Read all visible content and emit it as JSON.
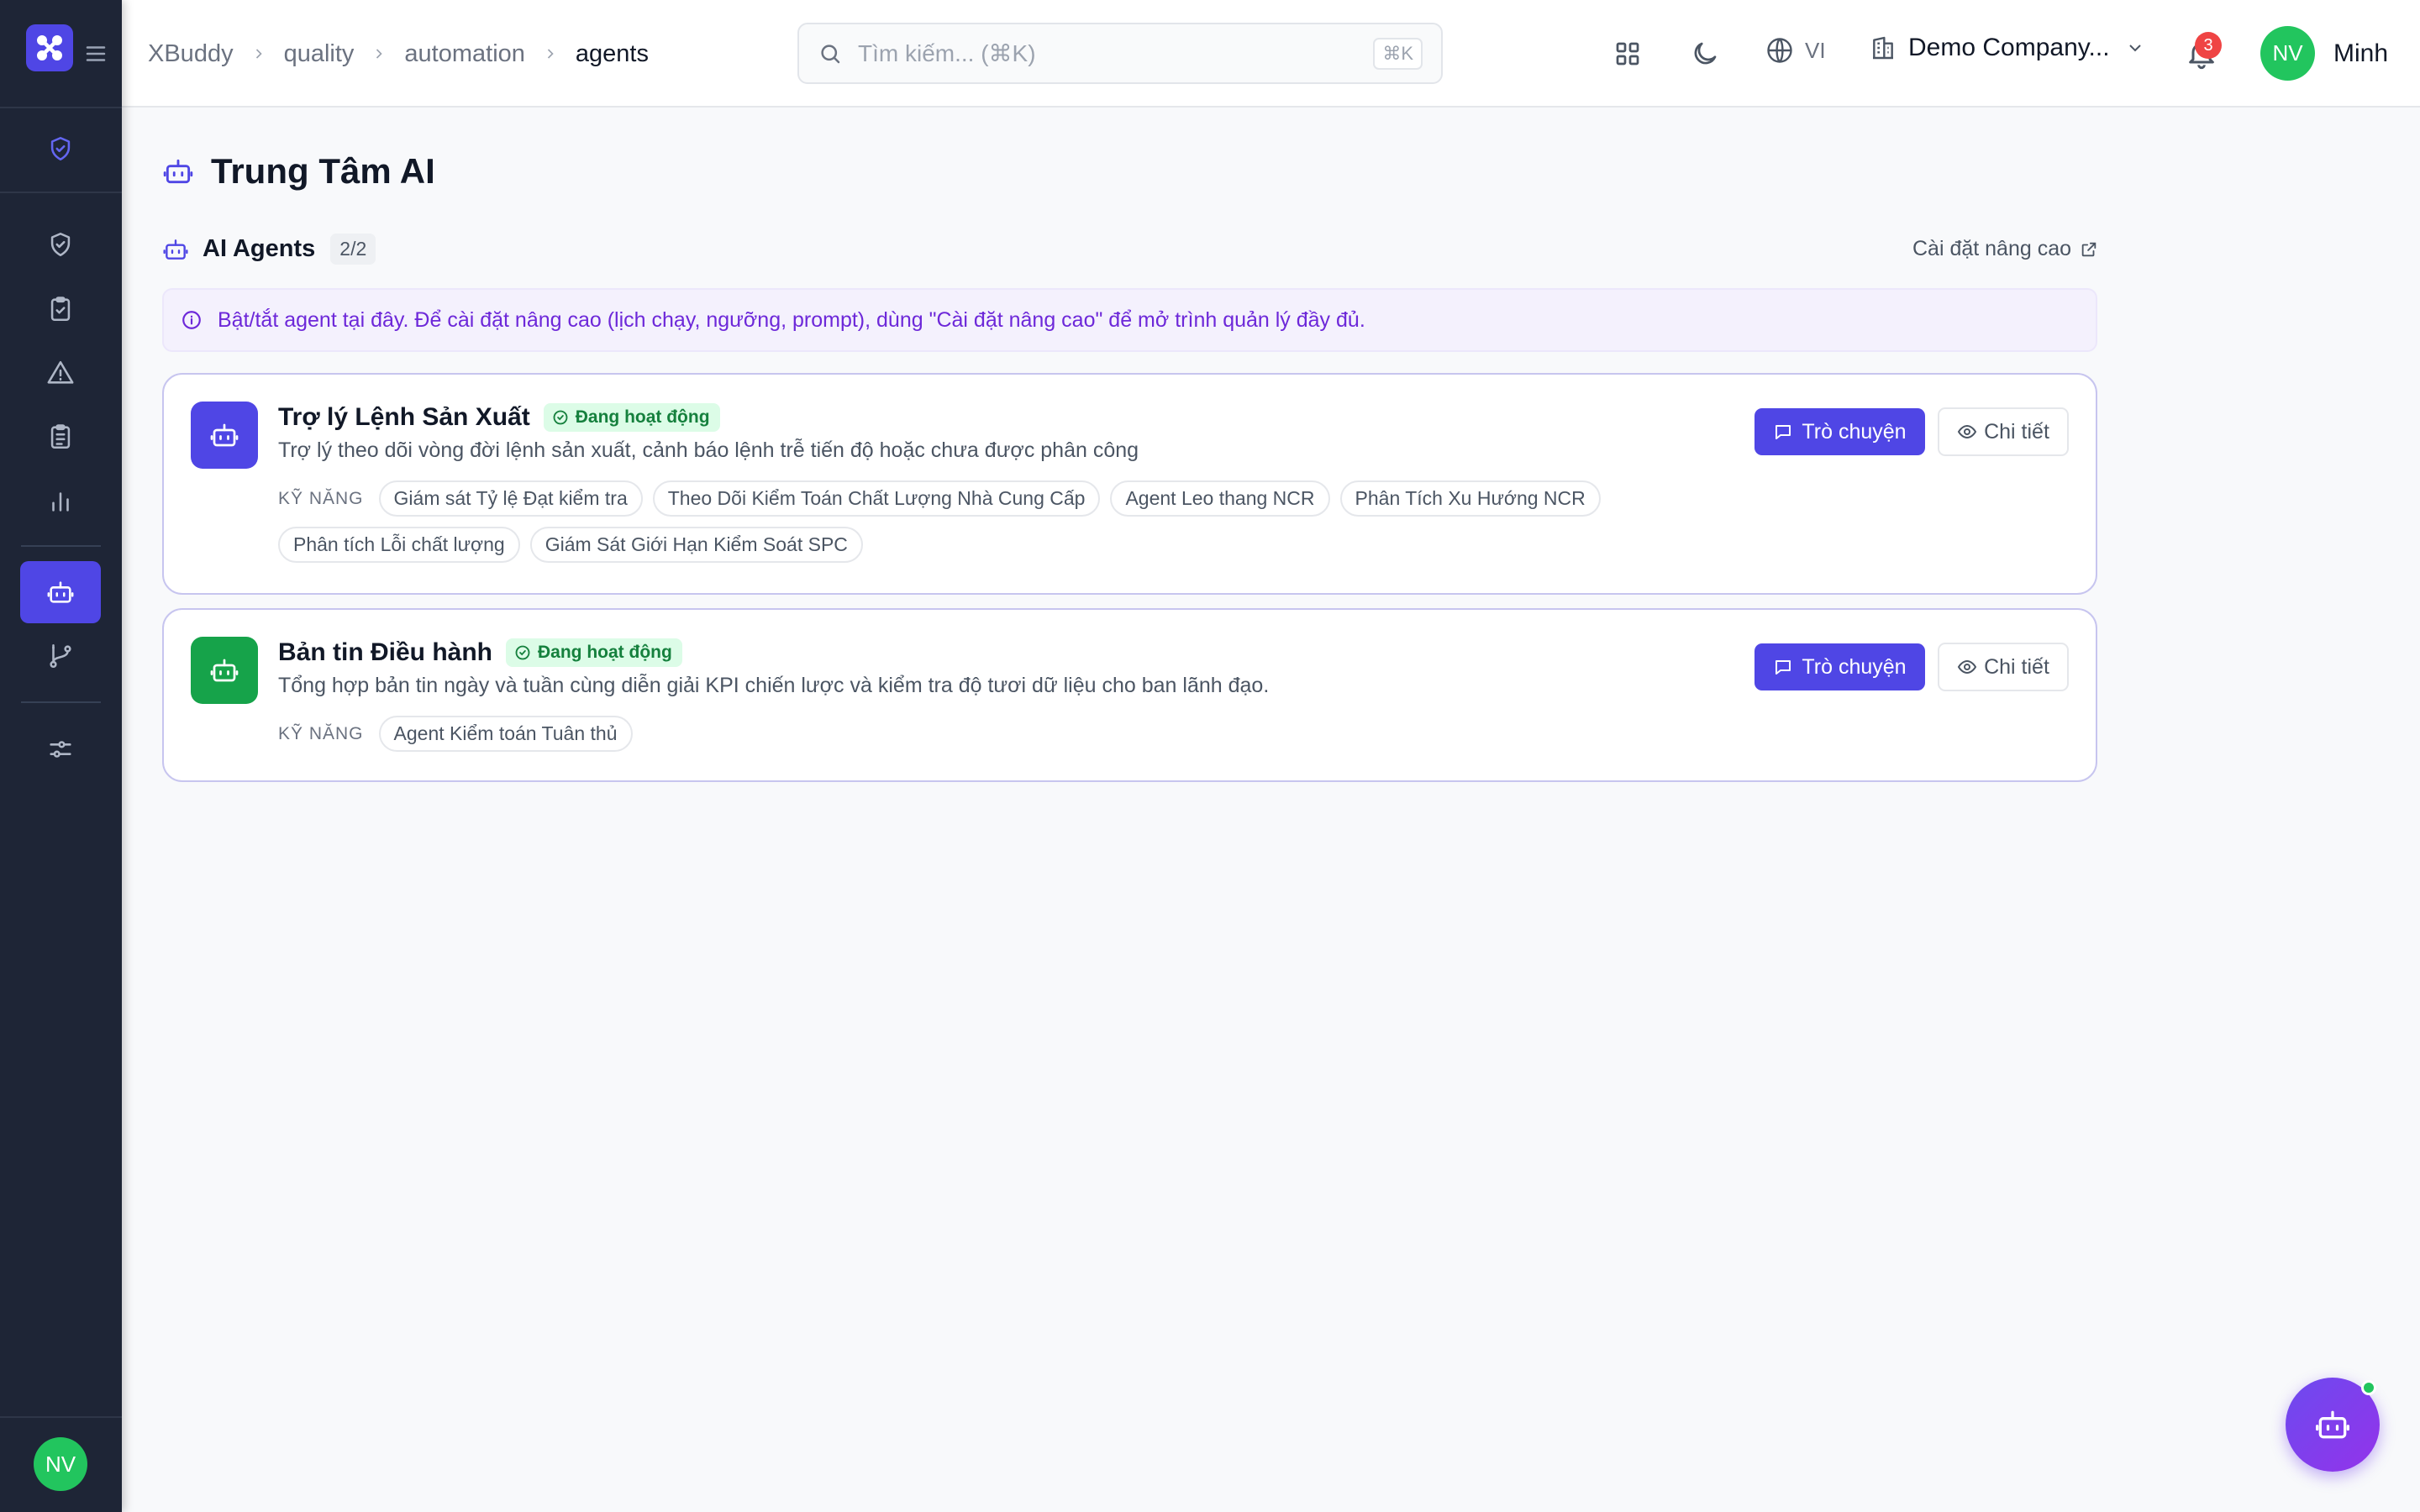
{
  "breadcrumb": [
    "XBuddy",
    "quality",
    "automation",
    "agents"
  ],
  "search": {
    "placeholder": "Tìm kiếm... (⌘K)",
    "shortcut": "⌘K"
  },
  "language": "VI",
  "company": "Demo Company...",
  "notifications": {
    "count": "3"
  },
  "user": {
    "initials": "NV",
    "name": "Minh"
  },
  "sidebar": {
    "items": [
      {
        "icon": "shield-check-icon"
      },
      {
        "icon": "shield-check-icon"
      },
      {
        "icon": "clipboard-check-icon"
      },
      {
        "icon": "warning-triangle-icon"
      },
      {
        "icon": "clipboard-list-icon"
      },
      {
        "icon": "bar-chart-icon"
      },
      {
        "icon": "bot-icon",
        "active": true
      },
      {
        "icon": "git-branch-icon"
      },
      {
        "icon": "sliders-icon"
      }
    ],
    "avatar": "NV"
  },
  "page": {
    "title": "Trung Tâm AI"
  },
  "section": {
    "title": "AI Agents",
    "count": "2/2",
    "advanced_link": "Cài đặt nâng cao",
    "info": "Bật/tắt agent tại đây. Để cài đặt nâng cao (lịch chạy, ngưỡng, prompt), dùng \"Cài đặt nâng cao\" để mở trình quản lý đầy đủ."
  },
  "skills_label": "KỸ NĂNG",
  "chat_label": "Trò chuyện",
  "detail_label": "Chi tiết",
  "agents": [
    {
      "name": "Trợ lý Lệnh Sản Xuất",
      "status": "Đang hoạt động",
      "description": "Trợ lý theo dõi vòng đời lệnh sản xuất, cảnh báo lệnh trễ tiến độ hoặc chưa được phân công",
      "icon_color": "#4f46e5",
      "skills": [
        "Giám sát Tỷ lệ Đạt kiểm tra",
        "Theo Dõi Kiểm Toán Chất Lượng Nhà Cung Cấp",
        "Agent Leo thang NCR",
        "Phân Tích Xu Hướng NCR",
        "Phân tích Lỗi chất lượng",
        "Giám Sát Giới Hạn Kiểm Soát SPC"
      ]
    },
    {
      "name": "Bản tin Điều hành",
      "status": "Đang hoạt động",
      "description": "Tổng hợp bản tin ngày và tuần cùng diễn giải KPI chiến lược và kiểm tra độ tươi dữ liệu cho ban lãnh đạo.",
      "icon_color": "#16a34a",
      "skills": [
        "Agent Kiểm toán Tuân thủ"
      ]
    }
  ],
  "colors": {
    "accent": "#4f46e5",
    "sidebar": "#1e2536",
    "success": "#22c55e"
  }
}
